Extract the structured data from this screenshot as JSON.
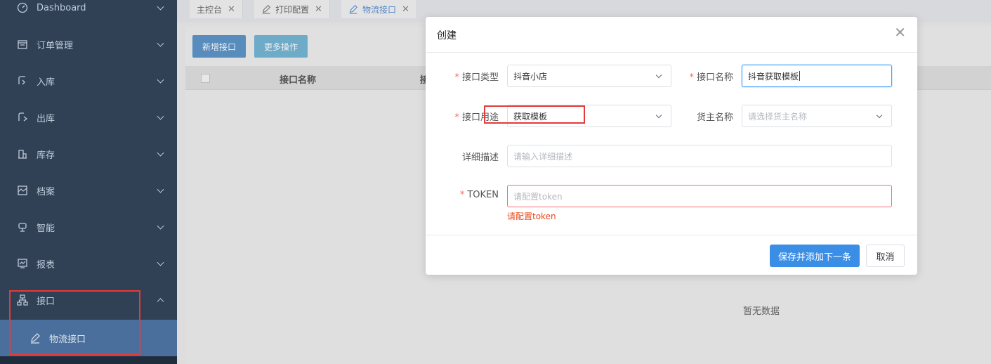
{
  "sidebar": {
    "items": [
      {
        "label": "Dashboard",
        "icon": "dashboard-icon"
      },
      {
        "label": "订单管理",
        "icon": "order-icon"
      },
      {
        "label": "入库",
        "icon": "inbound-icon"
      },
      {
        "label": "出库",
        "icon": "outbound-icon"
      },
      {
        "label": "库存",
        "icon": "inventory-icon"
      },
      {
        "label": "档案",
        "icon": "archive-icon"
      },
      {
        "label": "智能",
        "icon": "smart-icon"
      },
      {
        "label": "报表",
        "icon": "report-icon"
      },
      {
        "label": "接口",
        "icon": "interface-icon"
      }
    ],
    "sub_item": {
      "label": "物流接口",
      "icon": "pen-icon"
    }
  },
  "tabs": [
    {
      "label": "主控台"
    },
    {
      "label": "打印配置"
    },
    {
      "label": "物流接口"
    }
  ],
  "toolbar": {
    "add_label": "新增接口",
    "more_label": "更多操作"
  },
  "table": {
    "columns": [
      "接口名称",
      "接"
    ],
    "empty_text": "暂无数据"
  },
  "dialog": {
    "title": "创建",
    "fields": {
      "type": {
        "label": "接口类型",
        "value": "抖音小店"
      },
      "name": {
        "label": "接口名称",
        "value": "抖音获取模板"
      },
      "purpose": {
        "label": "接口用途",
        "value": "获取模板"
      },
      "owner": {
        "label": "货主名称",
        "placeholder": "请选择货主名称"
      },
      "desc": {
        "label": "详细描述",
        "placeholder": "请输入详细描述"
      },
      "token": {
        "label": "TOKEN",
        "placeholder": "请配置token",
        "error": "请配置token"
      }
    },
    "save_label": "保存并添加下一条",
    "cancel_label": "取消"
  },
  "colors": {
    "sidebar_bg": "#304156",
    "active_sub": "#4a6f9c",
    "primary": "#3a8ee6",
    "error": "#f56c6c",
    "highlight": "#e43a3a"
  }
}
